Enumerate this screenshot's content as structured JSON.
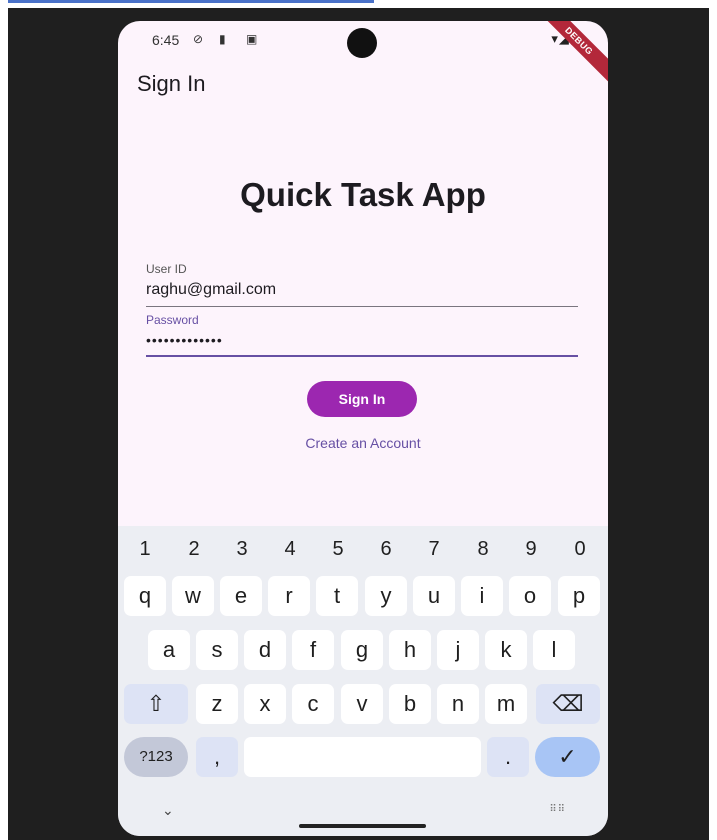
{
  "status": {
    "time": "6:45",
    "debug_label": "DEBUG"
  },
  "app_bar": {
    "title": "Sign In"
  },
  "hero": {
    "title": "Quick Task App"
  },
  "form": {
    "user_label": "User ID",
    "user_value": "raghu@gmail.com",
    "password_label": "Password",
    "password_value": "•••••••••••••"
  },
  "actions": {
    "sign_in": "Sign In",
    "create_account": "Create an Account"
  },
  "keyboard": {
    "numbers": [
      "1",
      "2",
      "3",
      "4",
      "5",
      "6",
      "7",
      "8",
      "9",
      "0"
    ],
    "row1": [
      "q",
      "w",
      "e",
      "r",
      "t",
      "y",
      "u",
      "i",
      "o",
      "p"
    ],
    "row2": [
      "a",
      "s",
      "d",
      "f",
      "g",
      "h",
      "j",
      "k",
      "l"
    ],
    "row3": [
      "z",
      "x",
      "c",
      "v",
      "b",
      "n",
      "m"
    ],
    "symbols_key": "?123",
    "comma_key": ",",
    "period_key": ".",
    "enter_key": "✓",
    "shift_key": "⇧",
    "backspace_key": "⌫"
  },
  "colors": {
    "primary": "#6750a4",
    "button": "#9c27b0",
    "background": "#fdf4fc"
  }
}
